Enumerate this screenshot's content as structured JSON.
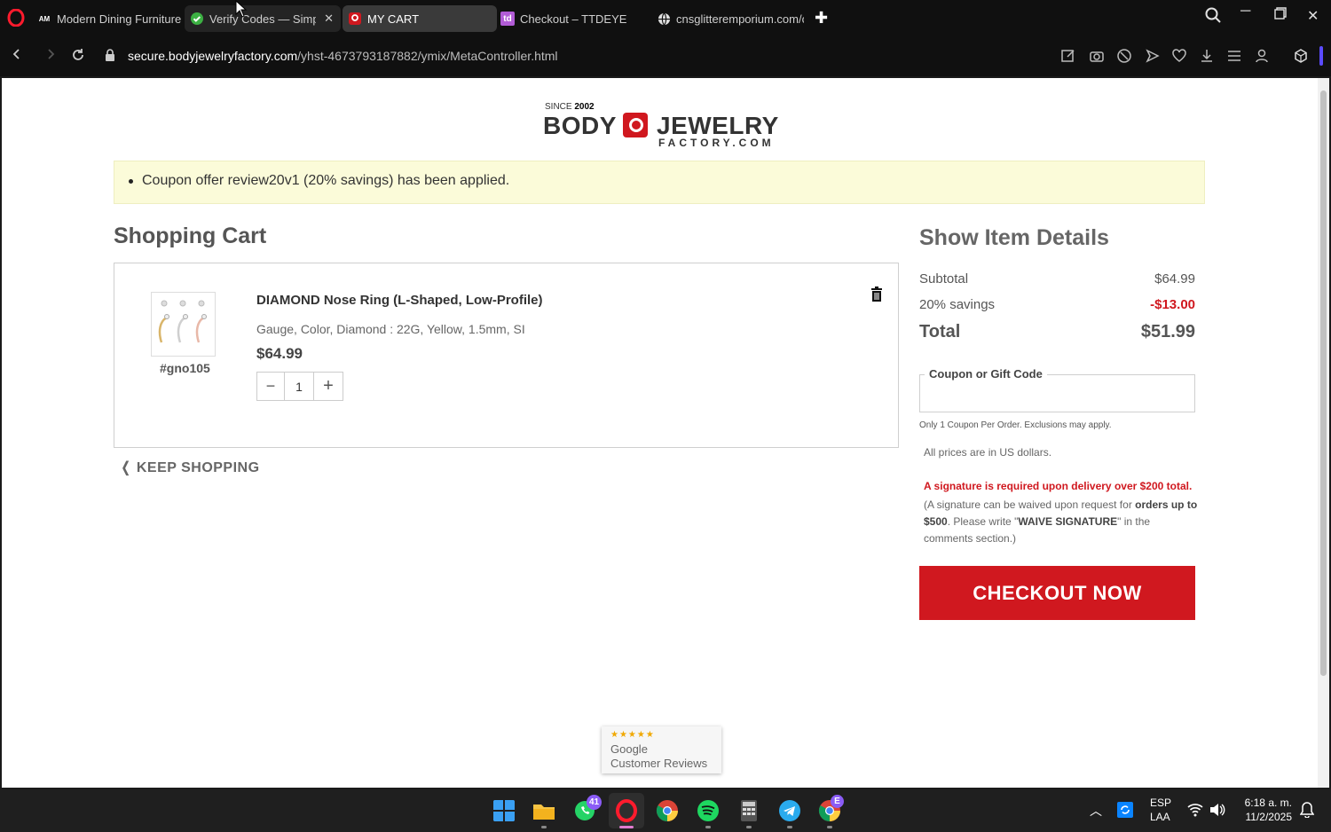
{
  "browser": {
    "tabs": [
      {
        "title": "Modern Dining Furniture |",
        "favicon": "AM"
      },
      {
        "title": "Verify Codes — Simply",
        "favicon": "check-circle"
      },
      {
        "title": "MY CART",
        "favicon": "bjf-logo"
      },
      {
        "title": "Checkout – TTDEYE",
        "favicon": "td"
      },
      {
        "title": "cnsglitteremporium.com/c",
        "favicon": "globe"
      }
    ],
    "url_host": "secure.bodyjewelryfactory.com",
    "url_path": "/yhst-4673793187882/ymix/MetaController.html"
  },
  "logo": {
    "since_label": "SINCE",
    "since_year": "2002",
    "word1": "BODY",
    "word2": "JEWELRY",
    "word3": "FACTORY.COM"
  },
  "notice": "Coupon offer review20v1 (20% savings) has been applied.",
  "cart": {
    "title": "Shopping Cart",
    "item": {
      "sku": "#gno105",
      "name": "DIAMOND Nose Ring (L-Shaped, Low-Profile)",
      "attrs": "Gauge, Color, Diamond : 22G, Yellow, 1.5mm, SI",
      "price": "$64.99",
      "qty": "1",
      "qty_minus": "−",
      "qty_plus": "+"
    },
    "keep_shopping": "KEEP SHOPPING"
  },
  "summary": {
    "title": "Show Item Details",
    "subtotal_label": "Subtotal",
    "subtotal_value": "$64.99",
    "savings_label": "20% savings",
    "savings_value": "-$13.00",
    "total_label": "Total",
    "total_value": "$51.99",
    "coupon_label": "Coupon or Gift Code",
    "coupon_value": "",
    "coupon_note": "Only 1 Coupon Per Order. Exclusions may apply.",
    "usd_note": "All prices are in US dollars.",
    "signature_warning": "A signature is required upon delivery over $200 total.",
    "sig_part1": "(A signature can be waived upon request for ",
    "sig_bold1": "orders up to $500",
    "sig_part2": ". Please write \"",
    "sig_bold2": "WAIVE SIGNATURE",
    "sig_part3": "\" in the comments section.)",
    "checkout_label": "CHECKOUT NOW"
  },
  "reviews": {
    "stars": "★★★★★",
    "line1": "Google",
    "line2": "Customer Reviews"
  },
  "taskbar": {
    "whatsapp_badge": "41",
    "chrome_badge": "E",
    "lang1": "ESP",
    "lang2": "LAA",
    "time": "6:18 a. m.",
    "date": "11/2/2025"
  },
  "colors": {
    "brand_red": "#d0181f",
    "notice_bg": "#fbfbd9"
  }
}
